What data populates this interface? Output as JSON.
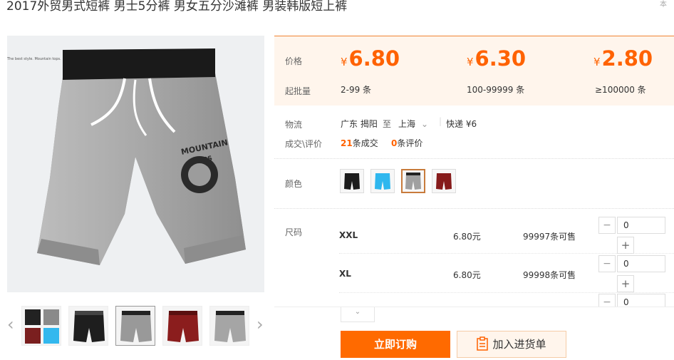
{
  "product": {
    "title": "2017外贸男式短裤 男士5分裤 男女五分沙滩裤 男装韩版短上裤",
    "image_tag": "The best style. Mountain tops."
  },
  "corner_mark": "本",
  "price_section": {
    "price_label": "价格",
    "moq_label": "起批量",
    "currency": "¥",
    "tiers": [
      {
        "price": "6.80",
        "range": "2-99 条"
      },
      {
        "price": "6.30",
        "range": "100-99999 条"
      },
      {
        "price": "2.80",
        "range": "≥100000 条"
      }
    ]
  },
  "logistics": {
    "label": "物流",
    "from": "广东 揭阳",
    "to_word": "至",
    "to": "上海",
    "express": "快递 ¥6"
  },
  "deals": {
    "label": "成交\\评价",
    "deal_count": "21",
    "deal_text": "条成交",
    "review_count": "0",
    "review_text": "条评价"
  },
  "color": {
    "label": "颜色",
    "swatches": [
      "black",
      "sky-blue",
      "grey",
      "maroon"
    ],
    "selected": "grey"
  },
  "size": {
    "label": "尺码",
    "rows": [
      {
        "name": "XXL",
        "price": "6.80元",
        "stock": "99997条可售",
        "qty": "0"
      },
      {
        "name": "XL",
        "price": "6.80元",
        "stock": "99998条可售",
        "qty": "0"
      },
      {
        "name": "",
        "price": "",
        "stock": "",
        "qty": "0"
      }
    ]
  },
  "actions": {
    "expand": "⌄",
    "buy_now": "立即订购",
    "add_to_list": "加入进货单"
  },
  "colors": {
    "accent": "#ff6200",
    "button": "#ff6a00",
    "price_bg": "#fff5ec"
  }
}
